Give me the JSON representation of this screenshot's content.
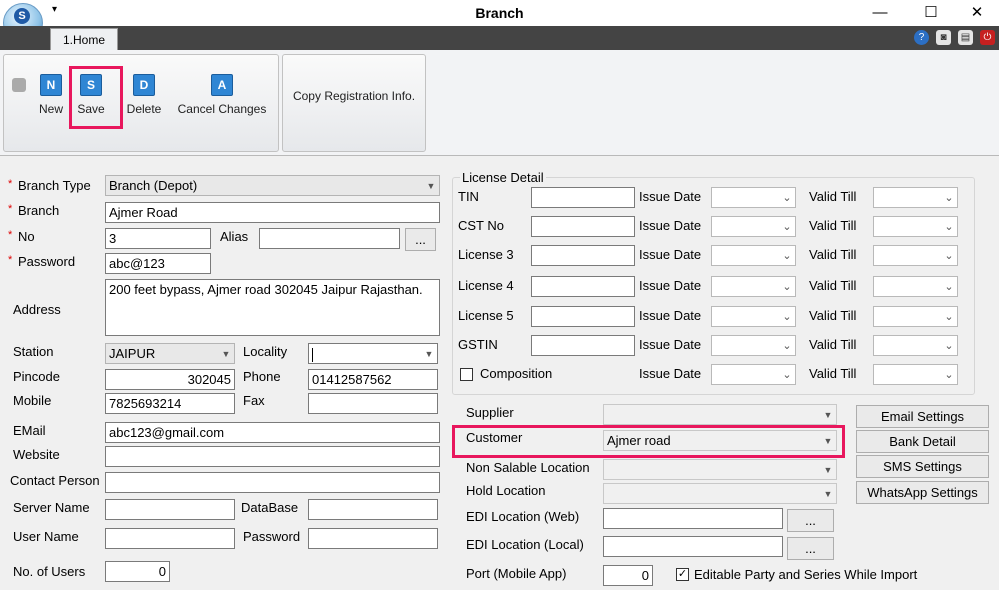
{
  "window": {
    "title": "Branch",
    "logo_letter": "S",
    "quick_access": "▾",
    "minimize": "—",
    "maximize": "☐",
    "close": "✕"
  },
  "tabs": [
    {
      "label": "1.Home"
    }
  ],
  "ribbon": {
    "new": {
      "label": "New",
      "icon": "N"
    },
    "save": {
      "label": "Save",
      "icon": "S"
    },
    "delete": {
      "label": "Delete",
      "icon": "D"
    },
    "cancel": {
      "label": "Cancel Changes",
      "icon": "A"
    },
    "copy_reg": "Copy Registration Info."
  },
  "form": {
    "required_mark": "*",
    "branch_type": {
      "label": "Branch Type",
      "value": "Branch (Depot)"
    },
    "branch": {
      "label": "Branch",
      "value": "Ajmer Road"
    },
    "no": {
      "label": "No",
      "value": "3"
    },
    "alias": {
      "label": "Alias",
      "value": ""
    },
    "alias_button": "...",
    "password": {
      "label": "Password",
      "value": "abc@123"
    },
    "address": {
      "label": "Address",
      "value": "200 feet bypass, Ajmer road 302045 Jaipur Rajasthan."
    },
    "station": {
      "label": "Station",
      "value": "JAIPUR"
    },
    "locality": {
      "label": "Locality",
      "value": ""
    },
    "pincode": {
      "label": "Pincode",
      "value": "302045"
    },
    "phone": {
      "label": "Phone",
      "value": "01412587562"
    },
    "mobile": {
      "label": "Mobile",
      "value": "7825693214"
    },
    "fax": {
      "label": "Fax",
      "value": ""
    },
    "email": {
      "label": "EMail",
      "value": "abc123@gmail.com"
    },
    "website": {
      "label": "Website",
      "value": ""
    },
    "contact_person": {
      "label": "Contact Person",
      "value": ""
    },
    "server_name": {
      "label": "Server Name",
      "value": ""
    },
    "database": {
      "label": "DataBase",
      "value": ""
    },
    "user_name": {
      "label": "User Name",
      "value": ""
    },
    "db_password": {
      "label": "Password",
      "value": ""
    },
    "no_of_users": {
      "label": "No. of Users",
      "value": "0"
    }
  },
  "license": {
    "title": "License Detail",
    "issue_label": "Issue Date",
    "valid_label": "Valid Till",
    "rows": [
      {
        "label": "TIN"
      },
      {
        "label": "CST No"
      },
      {
        "label": "License 3"
      },
      {
        "label": "License 4"
      },
      {
        "label": "License 5"
      },
      {
        "label": "GSTIN"
      }
    ],
    "composition": "Composition"
  },
  "locations": {
    "supplier": {
      "label": "Supplier",
      "value": ""
    },
    "customer": {
      "label": "Customer",
      "value": "Ajmer road"
    },
    "non_salable": {
      "label": "Non Salable Location",
      "value": ""
    },
    "hold": {
      "label": "Hold Location",
      "value": ""
    },
    "edi_web": {
      "label": "EDI Location (Web)",
      "value": ""
    },
    "edi_local": {
      "label": "EDI Location (Local)",
      "value": ""
    },
    "browse": "...",
    "port": {
      "label": "Port (Mobile App)",
      "value": "0"
    },
    "editable_party": "Editable Party and Series While Import"
  },
  "settings_buttons": {
    "email": "Email Settings",
    "bank": "Bank Detail",
    "sms": "SMS Settings",
    "whatsapp": "WhatsApp Settings"
  },
  "colors": {
    "highlight": "#e8175d",
    "ribbon_icon": "#2f86d4"
  }
}
